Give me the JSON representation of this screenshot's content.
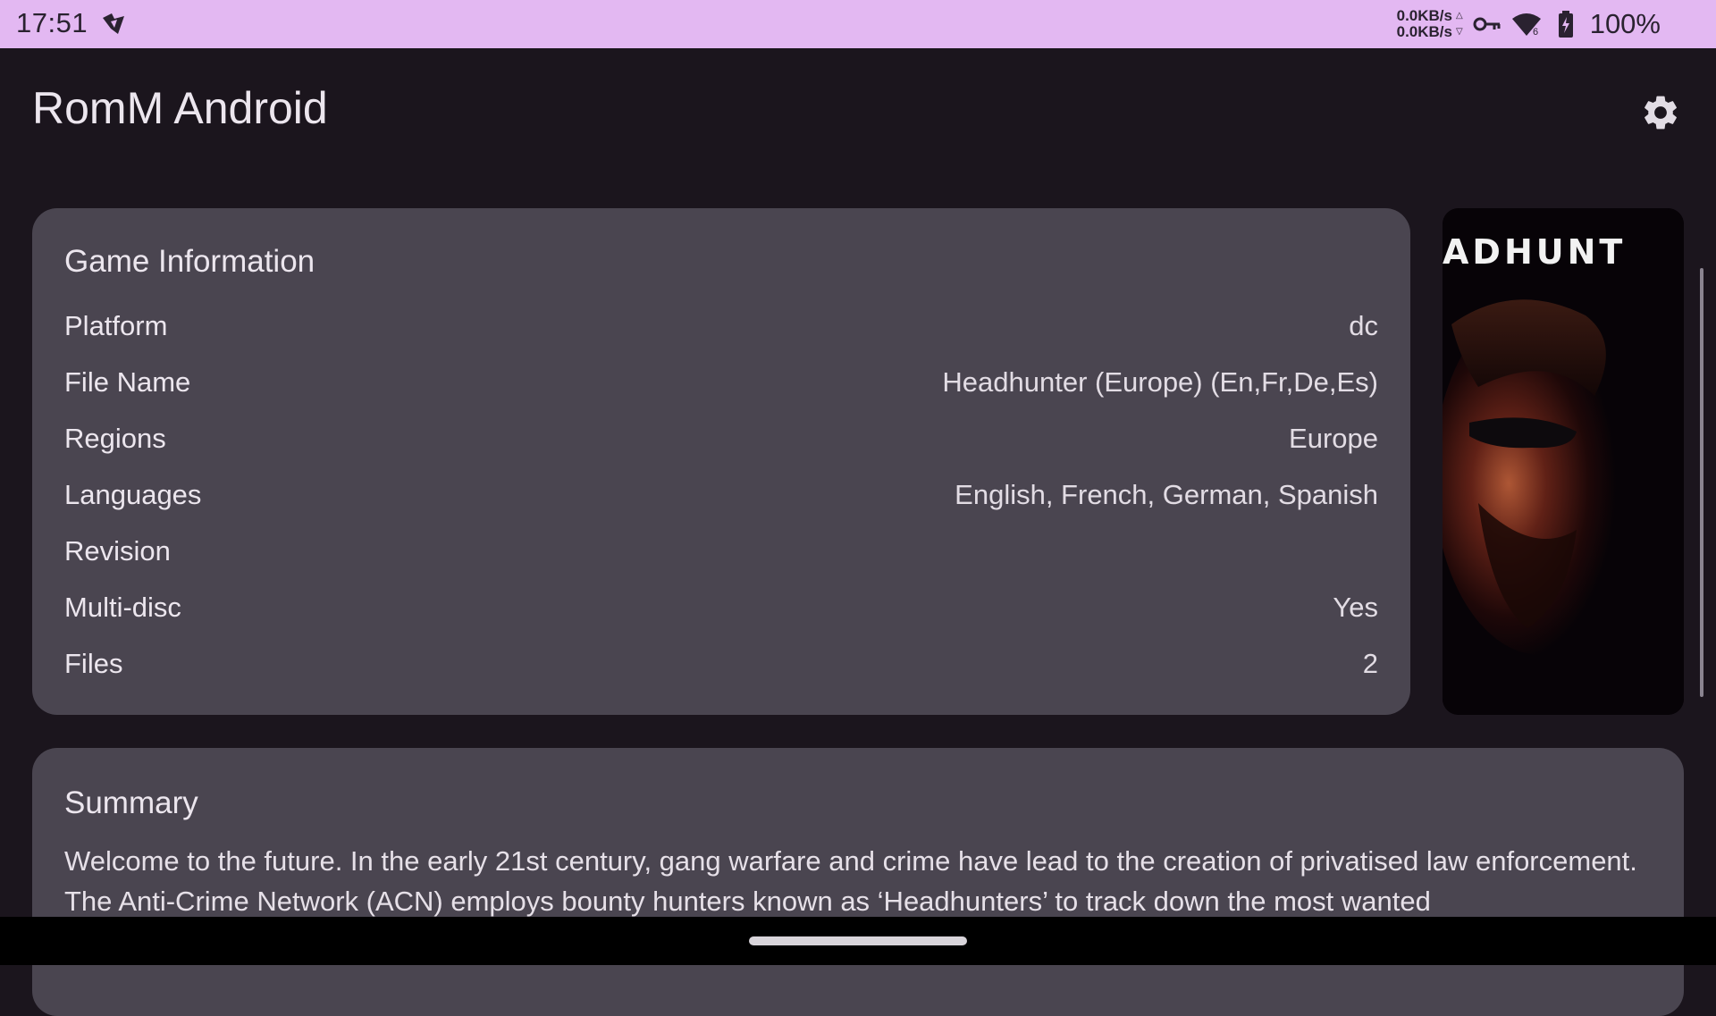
{
  "status_bar": {
    "time": "17:51",
    "net_up": "0.0KB/s",
    "net_down": "0.0KB/s",
    "battery": "100%",
    "icons": [
      "app-notification-icon",
      "vpn-key-icon",
      "wifi-icon",
      "battery-charging-icon"
    ]
  },
  "app": {
    "title": "RomM Android",
    "settings_icon": "gear-icon"
  },
  "game_info": {
    "title": "Game Information",
    "rows": [
      {
        "label": "Platform",
        "value": "dc"
      },
      {
        "label": "File Name",
        "value": "Headhunter (Europe) (En,Fr,De,Es)"
      },
      {
        "label": "Regions",
        "value": "Europe"
      },
      {
        "label": "Languages",
        "value": "English, French, German, Spanish"
      },
      {
        "label": "Revision",
        "value": ""
      },
      {
        "label": "Multi-disc",
        "value": "Yes"
      },
      {
        "label": "Files",
        "value": "2"
      }
    ]
  },
  "cover": {
    "text": "ADHUNT"
  },
  "summary": {
    "title": "Summary",
    "text": "Welcome to the future. In the early 21st century, gang warfare and crime have lead to the creation of privatised law enforcement. The Anti-Crime Network (ACN) employs bounty hunters known as ‘Headhunters’ to track down the most wanted"
  },
  "colors": {
    "status_bar": "#e3b8f2",
    "background": "#1b151d",
    "card": "#4a4550"
  }
}
